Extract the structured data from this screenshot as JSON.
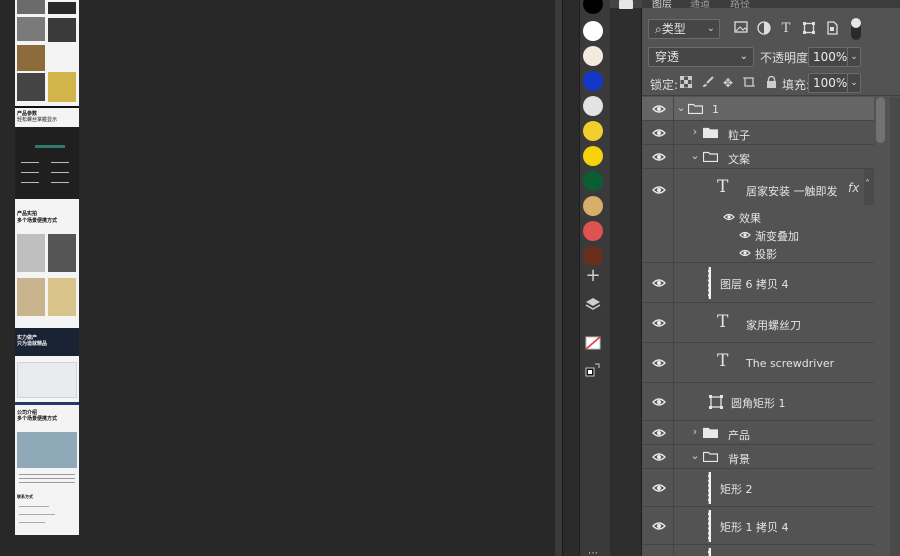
{
  "panel_tabs": [
    "图层",
    "通道",
    "路径"
  ],
  "filter": {
    "label": "类型",
    "icons": [
      "image-filter-icon",
      "adjustment-filter-icon",
      "type-filter-icon",
      "shape-filter-icon",
      "smart-object-filter-icon"
    ]
  },
  "blend": {
    "mode": "穿透",
    "opacity_label": "不透明度:",
    "opacity_value": "100%"
  },
  "lock": {
    "label": "锁定:",
    "fill_label": "填充:",
    "fill_value": "100%"
  },
  "swatches": [
    "#000000",
    "#ffffff",
    "#f3ebdd",
    "#1437c9",
    "#e3e3e3",
    "#f2cf2e",
    "#f6d20c",
    "#0b5d34",
    "#d7ae6a",
    "#de534f",
    "#6a2e1e"
  ],
  "layers": {
    "group_1": "1",
    "group_particles": "粒子",
    "group_copy": "文案",
    "text_main": "居家安装 一触即发",
    "fx_label": "fx",
    "effects_label": "效果",
    "effect_gradient": "渐变叠加",
    "effect_shadow": "投影",
    "layer6": "图层 6 拷贝 4",
    "text_knife": "家用螺丝刀",
    "text_screwdriver": "The screwdriver",
    "rounded_rect": "圆角矩形 1",
    "group_product": "产品",
    "group_bg": "背景",
    "rect2": "矩形 2",
    "rect1copy4": "矩形 1 拷贝 4"
  },
  "artboard": {
    "params_title": "产品参数",
    "params_sub": "轻松螺丝掌握显示",
    "usage_title": "产品实拍",
    "usage_sub": "多个场景便携方式",
    "quality_title": "实力做产",
    "quality_sub": "只为造就精品",
    "company_title": "公司介绍",
    "company_sub": "多个场景便携方式",
    "contact_label": "联系方式"
  }
}
